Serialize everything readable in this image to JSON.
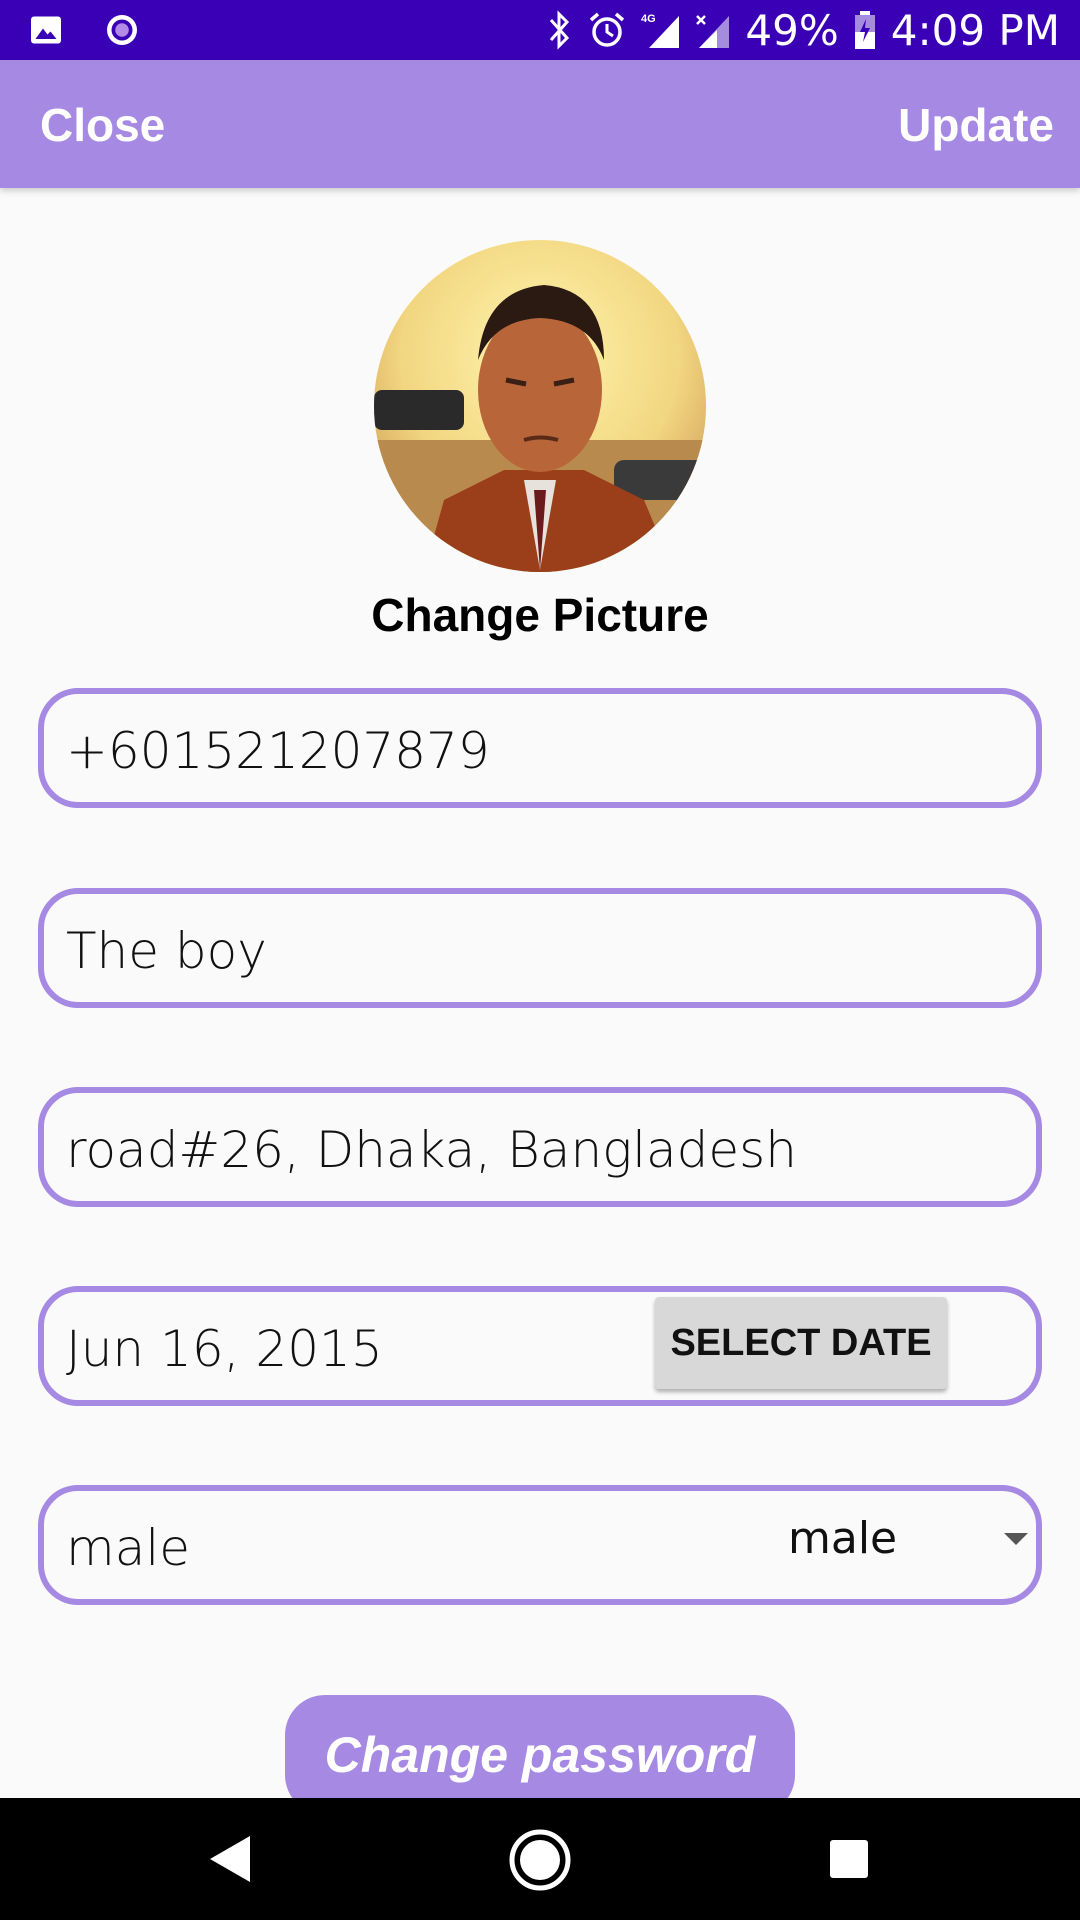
{
  "status_bar": {
    "battery": "49%",
    "time": "4:09 PM",
    "network": "4G"
  },
  "app_bar": {
    "close_label": "Close",
    "update_label": "Update"
  },
  "profile": {
    "change_picture_label": "Change Picture"
  },
  "fields": {
    "phone": "+601521207879",
    "name": "The boy",
    "address": "road#26, Dhaka, Bangladesh",
    "birthdate": "Jun 16, 2015",
    "select_date_label": "SELECT DATE",
    "gender_text": "male",
    "gender_selected": "male"
  },
  "buttons": {
    "change_password_label": "Change password"
  },
  "colors": {
    "status_bar": "#3a00b5",
    "accent": "#a589e3"
  }
}
